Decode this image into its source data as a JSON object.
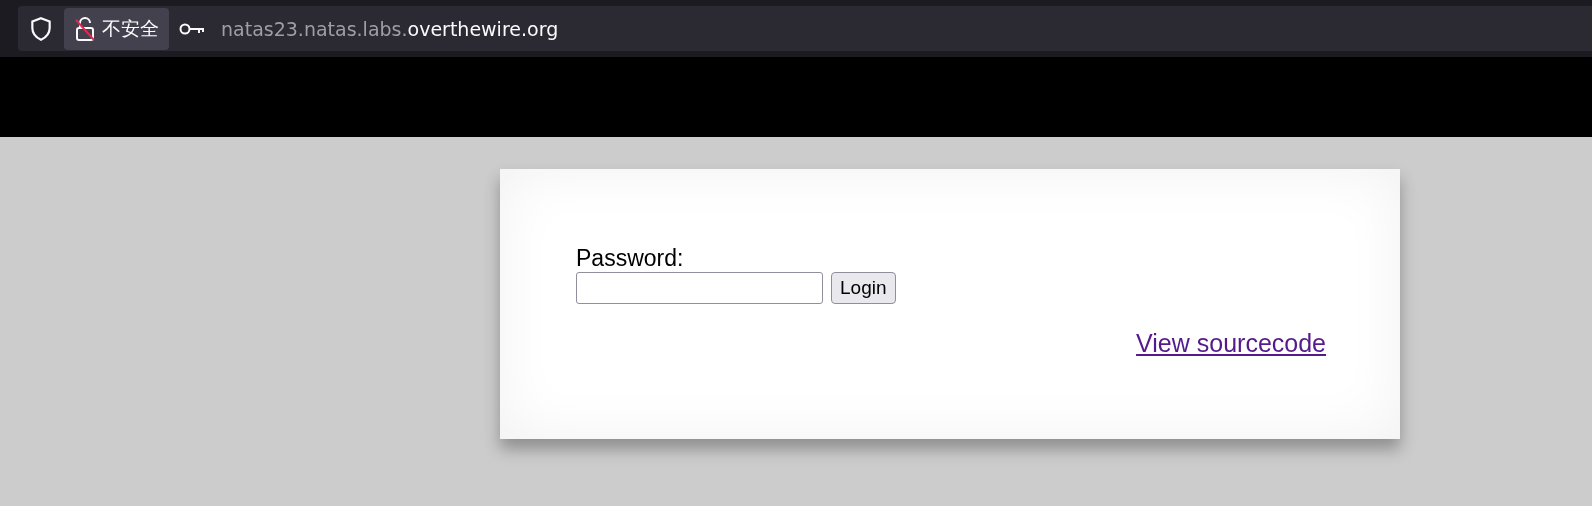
{
  "address_bar": {
    "security_label": "不安全",
    "url_subdomain": "natas23.natas.labs.",
    "url_domain": "overthewire.org"
  },
  "login_form": {
    "label": "Password:",
    "button": "Login"
  },
  "link": "View sourcecode"
}
